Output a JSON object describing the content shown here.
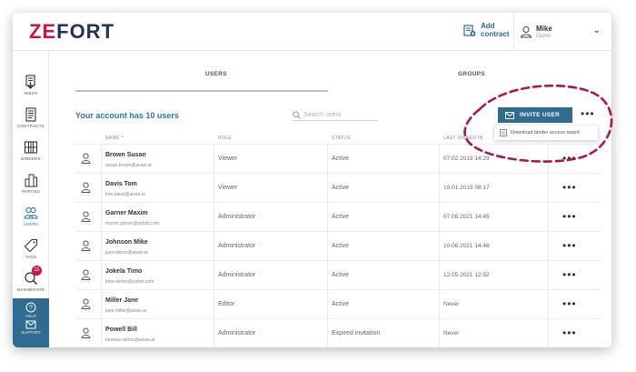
{
  "app": {
    "logo_ze": "ZE",
    "logo_fort": "FORT",
    "add_contract": [
      "Add",
      "contract"
    ],
    "user": {
      "name": "Mike",
      "role": "Demo"
    }
  },
  "sidebar": {
    "items": [
      {
        "label": "INBOX",
        "icon": "inbox-icon"
      },
      {
        "label": "CONTRACTS",
        "icon": "contracts-icon"
      },
      {
        "label": "BINDERS",
        "icon": "binders-icon"
      },
      {
        "label": "PARTIES",
        "icon": "parties-icon"
      },
      {
        "label": "USERS",
        "icon": "users-icon",
        "active": true
      },
      {
        "label": "TAGS",
        "icon": "tags-icon"
      },
      {
        "label": "DASHBOARD",
        "icon": "dashboard-icon",
        "badge": "11"
      }
    ],
    "help": "HELP",
    "support": "SUPPORT"
  },
  "tabs": {
    "users": "USERS",
    "groups": "GROUPS"
  },
  "summary": "Your account has 10 users",
  "search": {
    "placeholder": "Search users"
  },
  "invite_button": "INVITE USER",
  "dropdown": {
    "item": "Download binder access report"
  },
  "table": {
    "headers": {
      "name": "NAME ^",
      "role": "ROLE",
      "status": "STATUS",
      "last": "LAST SIGNED IN"
    },
    "rows": [
      {
        "name": "Brown Susan",
        "email": "susan.brown@aivan.ai",
        "role": "Viewer",
        "status": "Active",
        "last": "07.02.2019 14:29"
      },
      {
        "name": "Davis Tom",
        "email": "tom.davis@aivan.ai",
        "role": "Viewer",
        "status": "Active",
        "last": "10.01.2019 08:17"
      },
      {
        "name": "Garner Maxim",
        "email": "maxim.garner@zefort.com",
        "role": "Administrator",
        "status": "Active",
        "last": "07.06.2021 14:45"
      },
      {
        "name": "Johnson Mike",
        "email": "juss+demo@aivan.ai",
        "role": "Administrator",
        "status": "Active",
        "last": "10.06.2021 14:46"
      },
      {
        "name": "Jokela Timo",
        "email": "timo+demo@zefort.com",
        "role": "Administrator",
        "status": "Active",
        "last": "12.05.2021 12:52"
      },
      {
        "name": "Miller Jane",
        "email": "jane.miller@aivan.ai",
        "role": "Editor",
        "status": "Active",
        "last": "Never"
      },
      {
        "name": "Powell Bill",
        "email": "tuomas+demo@aivan.ai",
        "role": "Administrator",
        "status": "Expired invitation",
        "last": "Never"
      }
    ],
    "more": "•••"
  },
  "colors": {
    "brand_red": "#d0143e",
    "brand_navy": "#25315a",
    "accent": "#2f6c8f",
    "annotation": "#b0144c"
  }
}
